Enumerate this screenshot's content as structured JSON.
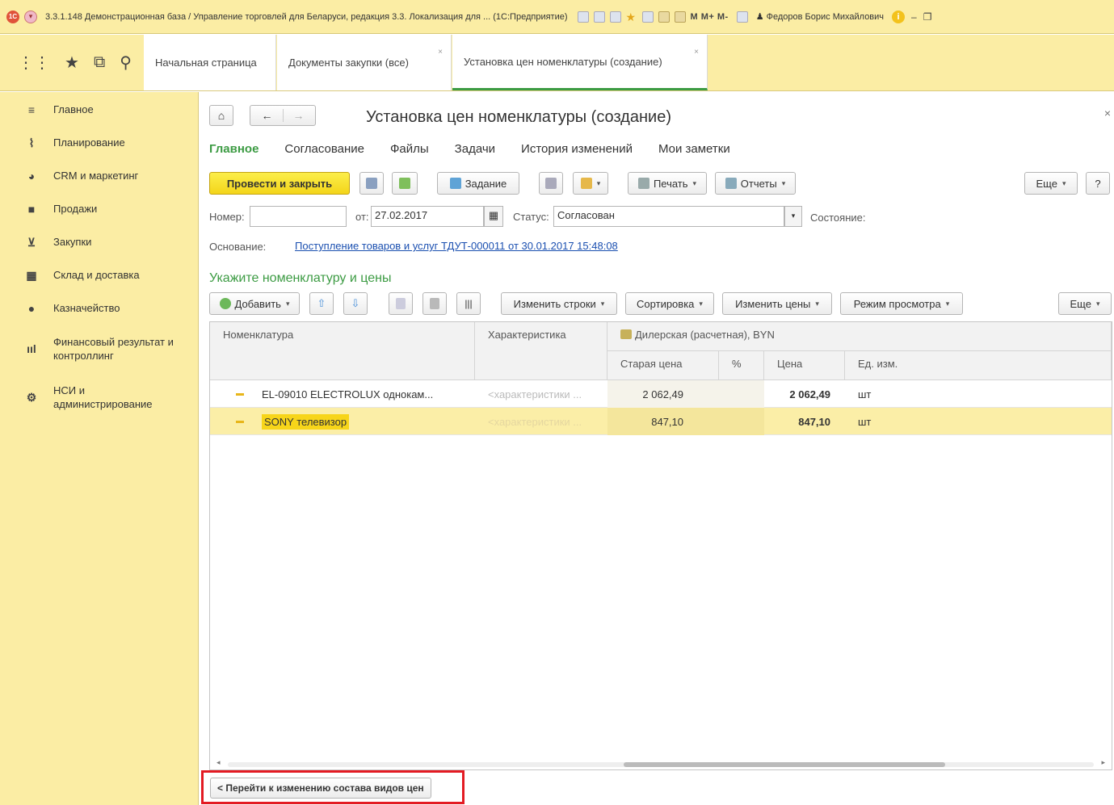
{
  "window": {
    "logo": "1С",
    "title": "3.3.1.148 Демонстрационная база / Управление торговлей для Беларуси, редакция 3.3. Локализация для ... (1С:Предприятие)",
    "mem_buttons": "M  M+  M-",
    "user": "Федоров Борис Михайлович"
  },
  "tabs": [
    {
      "label": "Начальная страница"
    },
    {
      "label": "Документы закупки (все)",
      "close": "×"
    },
    {
      "label": "Установка цен номенклатуры (создание)",
      "close": "×"
    }
  ],
  "sidebar": {
    "items": [
      {
        "label": "Главное"
      },
      {
        "label": "Планирование"
      },
      {
        "label": "CRM и маркетинг"
      },
      {
        "label": "Продажи"
      },
      {
        "label": "Закупки"
      },
      {
        "label": "Склад и доставка"
      },
      {
        "label": "Казначейство"
      },
      {
        "label": "Финансовый результат и контроллинг"
      },
      {
        "label": "НСИ и администрирование"
      }
    ]
  },
  "form": {
    "title": "Установка цен номенклатуры (создание)",
    "tabs": [
      "Главное",
      "Согласование",
      "Файлы",
      "Задачи",
      "История изменений",
      "Мои заметки"
    ],
    "toolbar": {
      "post_close": "Провести и закрыть",
      "task": "Задание",
      "print": "Печать",
      "reports": "Отчеты",
      "more": "Еще",
      "help": "?"
    },
    "number_label": "Номер:",
    "number_value": "",
    "date_label": "от:",
    "date_value": "27.02.2017",
    "status_label": "Статус:",
    "status_value": "Согласован",
    "state_label": "Состояние:",
    "basis_label": "Основание:",
    "basis_link": "Поступление товаров и услуг ТДУТ-000011 от 30.01.2017 15:48:08"
  },
  "section": {
    "title": "Укажите номенклатуру и цены",
    "toolbar": {
      "add": "Добавить",
      "change_rows": "Изменить строки",
      "sort": "Сортировка",
      "change_prices": "Изменить цены",
      "view_mode": "Режим просмотра",
      "more": "Еще"
    }
  },
  "table": {
    "headers": {
      "item": "Номенклатура",
      "characteristic": "Характеристика",
      "price_type": "Дилерская (расчетная), BYN",
      "old_price": "Старая цена",
      "percent": "%",
      "price": "Цена",
      "unit": "Ед. изм."
    },
    "rows": [
      {
        "item": "EL-09010 ELECTROLUX однокам...",
        "characteristic": "<характеристики ...",
        "old_price": "2 062,49",
        "percent": "",
        "price": "2 062,49",
        "unit": "шт"
      },
      {
        "item": "SONY телевизор",
        "characteristic": "<характеристики ...",
        "old_price": "847,10",
        "percent": "",
        "price": "847,10",
        "unit": "шт"
      }
    ]
  },
  "footer": {
    "button": "< Перейти к изменению состава видов цен"
  }
}
